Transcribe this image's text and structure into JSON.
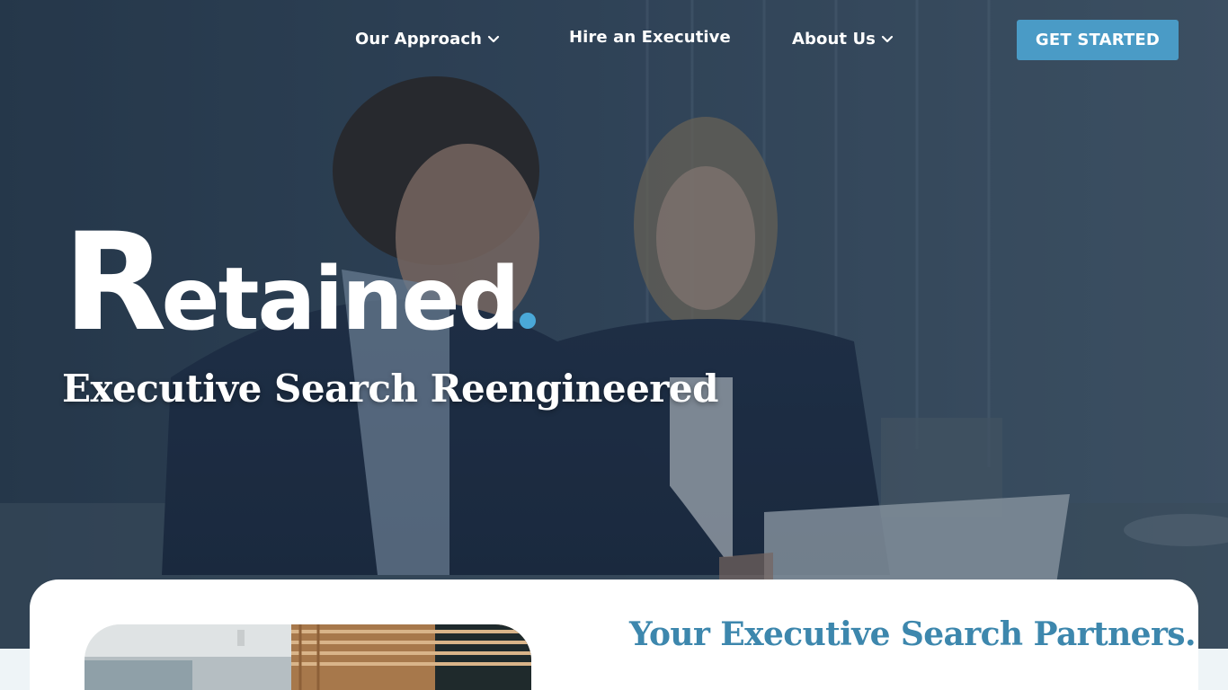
{
  "nav": {
    "items": [
      {
        "label": "Our Approach",
        "has_dropdown": true
      },
      {
        "label": "Hire an Executive",
        "has_dropdown": false
      },
      {
        "label": "About Us",
        "has_dropdown": true
      }
    ],
    "cta_label": "GET STARTED"
  },
  "hero": {
    "logo_text": "Retained",
    "logo_dot_color": "#4aa8d8",
    "tagline": "Executive Search Reengineered"
  },
  "section": {
    "heading": "Your Executive Search Partners",
    "heading_period": "."
  },
  "colors": {
    "accent": "#4a9bc6",
    "heading": "#3d87ad"
  }
}
